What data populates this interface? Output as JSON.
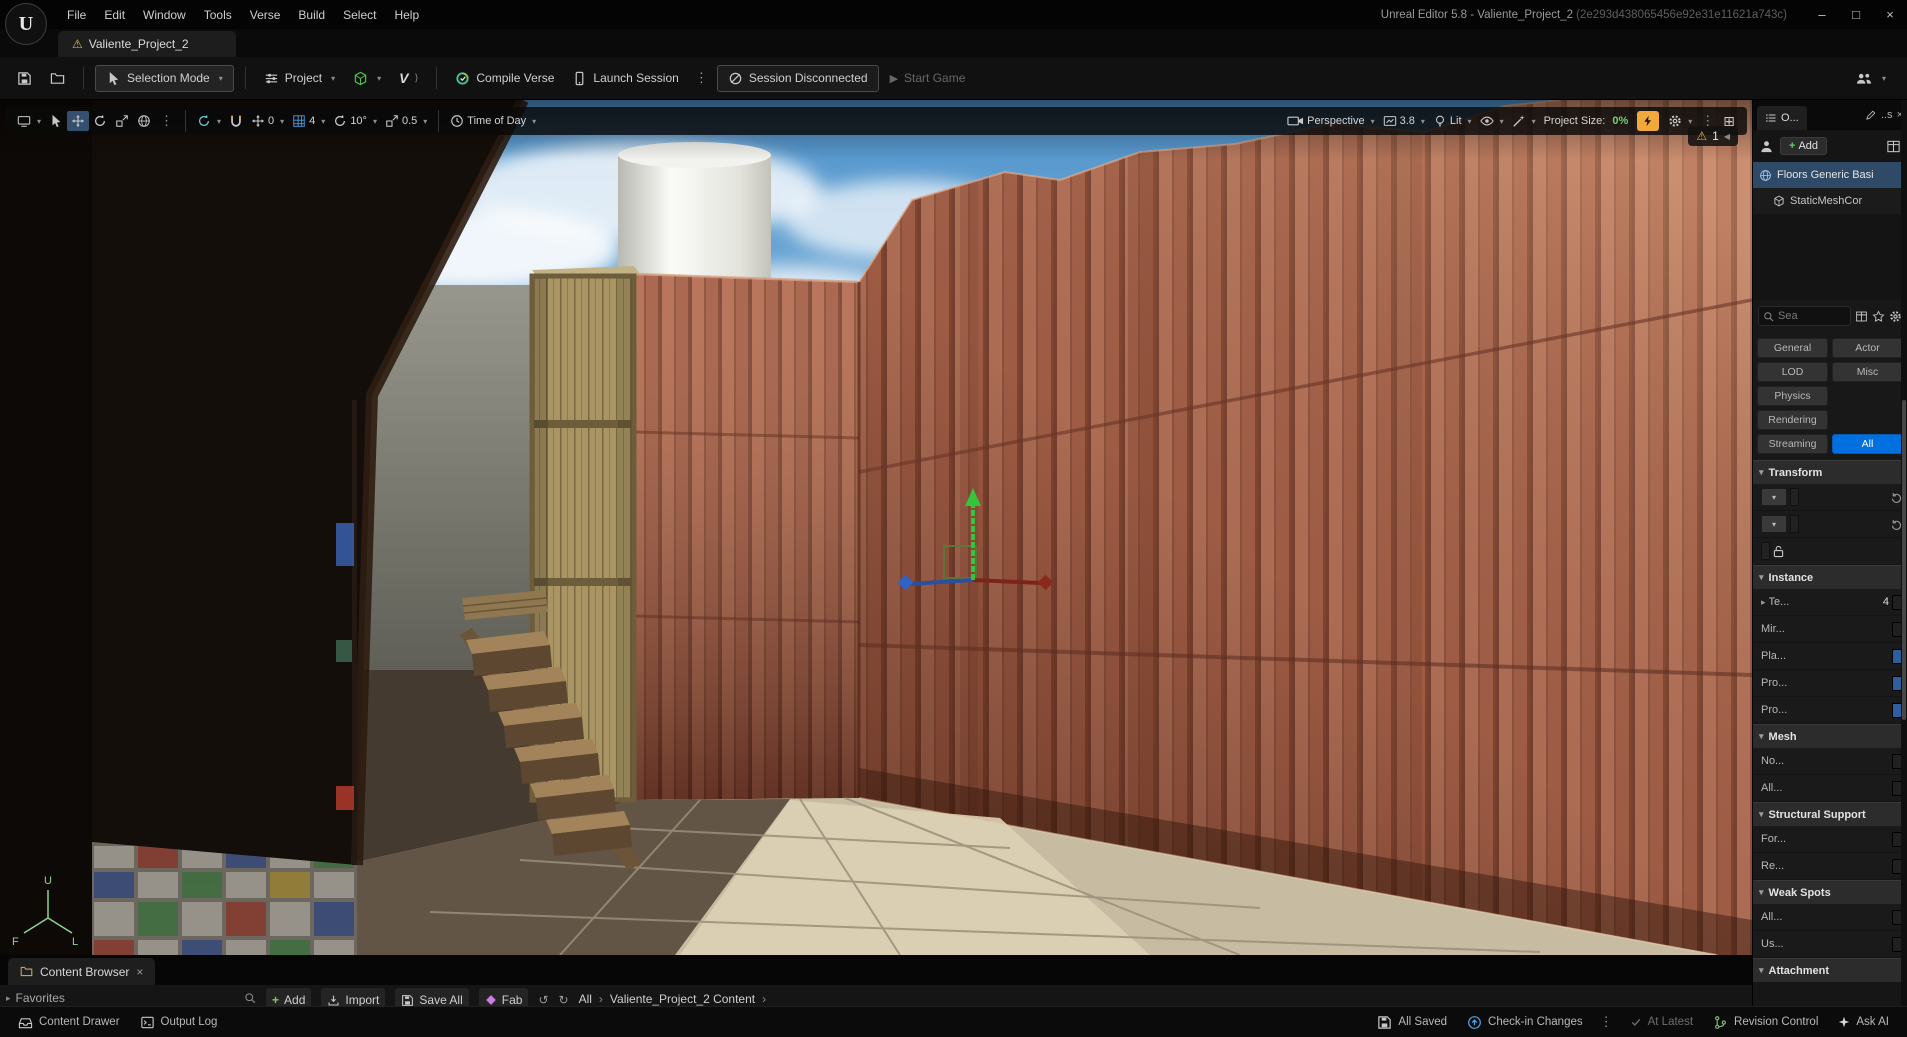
{
  "window": {
    "title": "Unreal Editor 5.8 - Valiente_Project_2",
    "title_id": "(2e293d438065456e92e31e11621a743c)"
  },
  "menubar": {
    "items": [
      "File",
      "Edit",
      "Window",
      "Tools",
      "Verse",
      "Build",
      "Select",
      "Help"
    ]
  },
  "project_tab": {
    "label": "Valiente_Project_2"
  },
  "toolbar": {
    "selection_mode": "Selection Mode",
    "project": "Project",
    "compile_verse": "Compile Verse",
    "launch_session": "Launch Session",
    "session_status": "Session Disconnected",
    "start_game": "Start Game"
  },
  "viewport_toolbar": {
    "location_snap": "0",
    "grid_snap": "4",
    "rotation_snap": "10°",
    "scale_snap": "0.5",
    "time_of_day": "Time of Day",
    "camera": "Perspective",
    "screen_percentage": "3.8",
    "view_mode": "Lit",
    "project_size_label": "Project Size:",
    "project_size_value": "0%"
  },
  "viewport": {
    "warning_count": "1",
    "axis_up": "U",
    "axis_f": "F",
    "axis_l": "L"
  },
  "outliner": {
    "tab": "O...",
    "tab2": "..s",
    "add": "Add",
    "item1": "Floors Generic Basi",
    "item2": "StaticMeshCor"
  },
  "details": {
    "search_placeholder": "Sea",
    "filters": [
      "General",
      "Actor",
      "LOD",
      "Misc",
      "Physics",
      "Rendering",
      "Streaming",
      "All"
    ],
    "sections": {
      "transform": "Transform",
      "instance": "Instance",
      "mesh": "Mesh",
      "structural": "Structural Support",
      "weak": "Weak Spots",
      "attachment": "Attachment"
    },
    "rows": {
      "te": "Te...",
      "te_value": "4",
      "mir": "Mir...",
      "pla": "Pla...",
      "pro1": "Pro...",
      "pro2": "Pro...",
      "no": "No...",
      "all1": "All...",
      "for": "For...",
      "re": "Re...",
      "all2": "All...",
      "us": "Us..."
    }
  },
  "content_browser": {
    "tab": "Content Browser",
    "favorites": "Favorites",
    "add": "Add",
    "import": "Import",
    "save_all": "Save All",
    "fab": "Fab",
    "breadcrumb_root": "All",
    "breadcrumb_path": "Valiente_Project_2 Content"
  },
  "statusbar": {
    "content_drawer": "Content Drawer",
    "output_log": "Output Log",
    "all_saved": "All Saved",
    "checkin": "Check-in Changes",
    "at_latest": "At Latest",
    "revision_control": "Revision Control",
    "ask_ai": "Ask AI"
  },
  "colors": {
    "accent_blue": "#0070e0",
    "selection_blue": "#2e4a67",
    "warning_yellow": "#f3b53a",
    "success_green": "#6fd46f",
    "boost_orange": "#f2a93b",
    "wood_red": "#b06a52"
  }
}
